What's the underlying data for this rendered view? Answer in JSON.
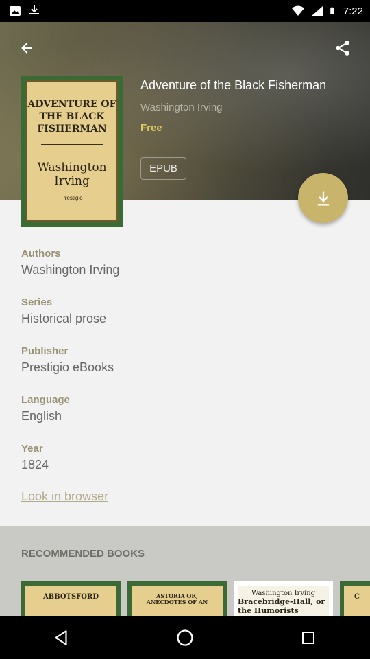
{
  "status_bar": {
    "time": "7:22"
  },
  "book": {
    "title": "Adventure of the Black Fisherman",
    "author": "Washington Irving",
    "price": "Free",
    "format": "EPUB",
    "cover": {
      "title": "Adventure of the Black Fisherman",
      "author": "Washington Irving",
      "publisher": "Prestigio"
    }
  },
  "details": [
    {
      "label": "Authors",
      "value": "Washington Irving"
    },
    {
      "label": "Series",
      "value": "Historical prose"
    },
    {
      "label": "Publisher",
      "value": "Prestigio eBooks"
    },
    {
      "label": "Language",
      "value": "English"
    },
    {
      "label": "Year",
      "value": "1824"
    }
  ],
  "look_in_browser": "Look in browser",
  "recommended": {
    "title": "RECOMMENDED BOOKS",
    "books": [
      {
        "cover_text": "ABBOTSFORD"
      },
      {
        "cover_text": "ASTORIA OR, ANECDOTES OF AN"
      },
      {
        "top_text": "Washington Irving",
        "cover_text": "Bracebridge-Hall, or the Humorists"
      },
      {
        "cover_text": "C"
      }
    ]
  },
  "colors": {
    "accent": "#c8b46a",
    "price": "#d8c865",
    "label": "#9a9276"
  }
}
